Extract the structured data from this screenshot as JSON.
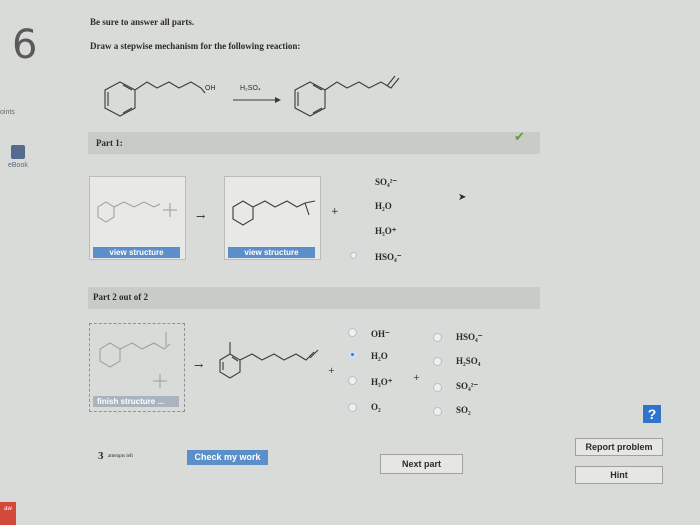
{
  "question_number": "6",
  "side": {
    "points_label": "oints",
    "ebook_label": "eBook",
    "tab_label": "aw"
  },
  "instructions": {
    "line1": "Be sure to answer all parts.",
    "line2": "Draw a stepwise mechanism for the following reaction:"
  },
  "reaction": {
    "reactant_group": "OH",
    "reagent": "H₂SO₄"
  },
  "part1": {
    "label": "Part 1:",
    "view_structure_1": "view structure",
    "view_structure_2": "view structure",
    "plus": "+",
    "arrow": "→",
    "options": [
      "SO₄²⁻",
      "H₂O",
      "H₃O⁺",
      "HSO₄⁻"
    ]
  },
  "part2": {
    "label": "Part 2 out of 2",
    "finish_structure": "finish structure ...",
    "plus": "+",
    "arrow": "→",
    "options_left": [
      "OH⁻",
      "H₂O",
      "H₃O⁺",
      "O₂"
    ],
    "options_right": [
      "HSO₄⁻",
      "H₂SO₄",
      "SO₄²⁻",
      "SO₂"
    ],
    "selected_left_index": 1
  },
  "footer": {
    "attempts_count": "3",
    "attempts_text": "attempts left",
    "check_button": "Check my work",
    "next_button": "Next part",
    "report_button": "Report problem",
    "hint_button": "Hint",
    "help_icon": "?"
  },
  "colors": {
    "accent_blue": "#5b8fc9",
    "check_green": "#5aa03c",
    "help_blue": "#2f74c9"
  }
}
